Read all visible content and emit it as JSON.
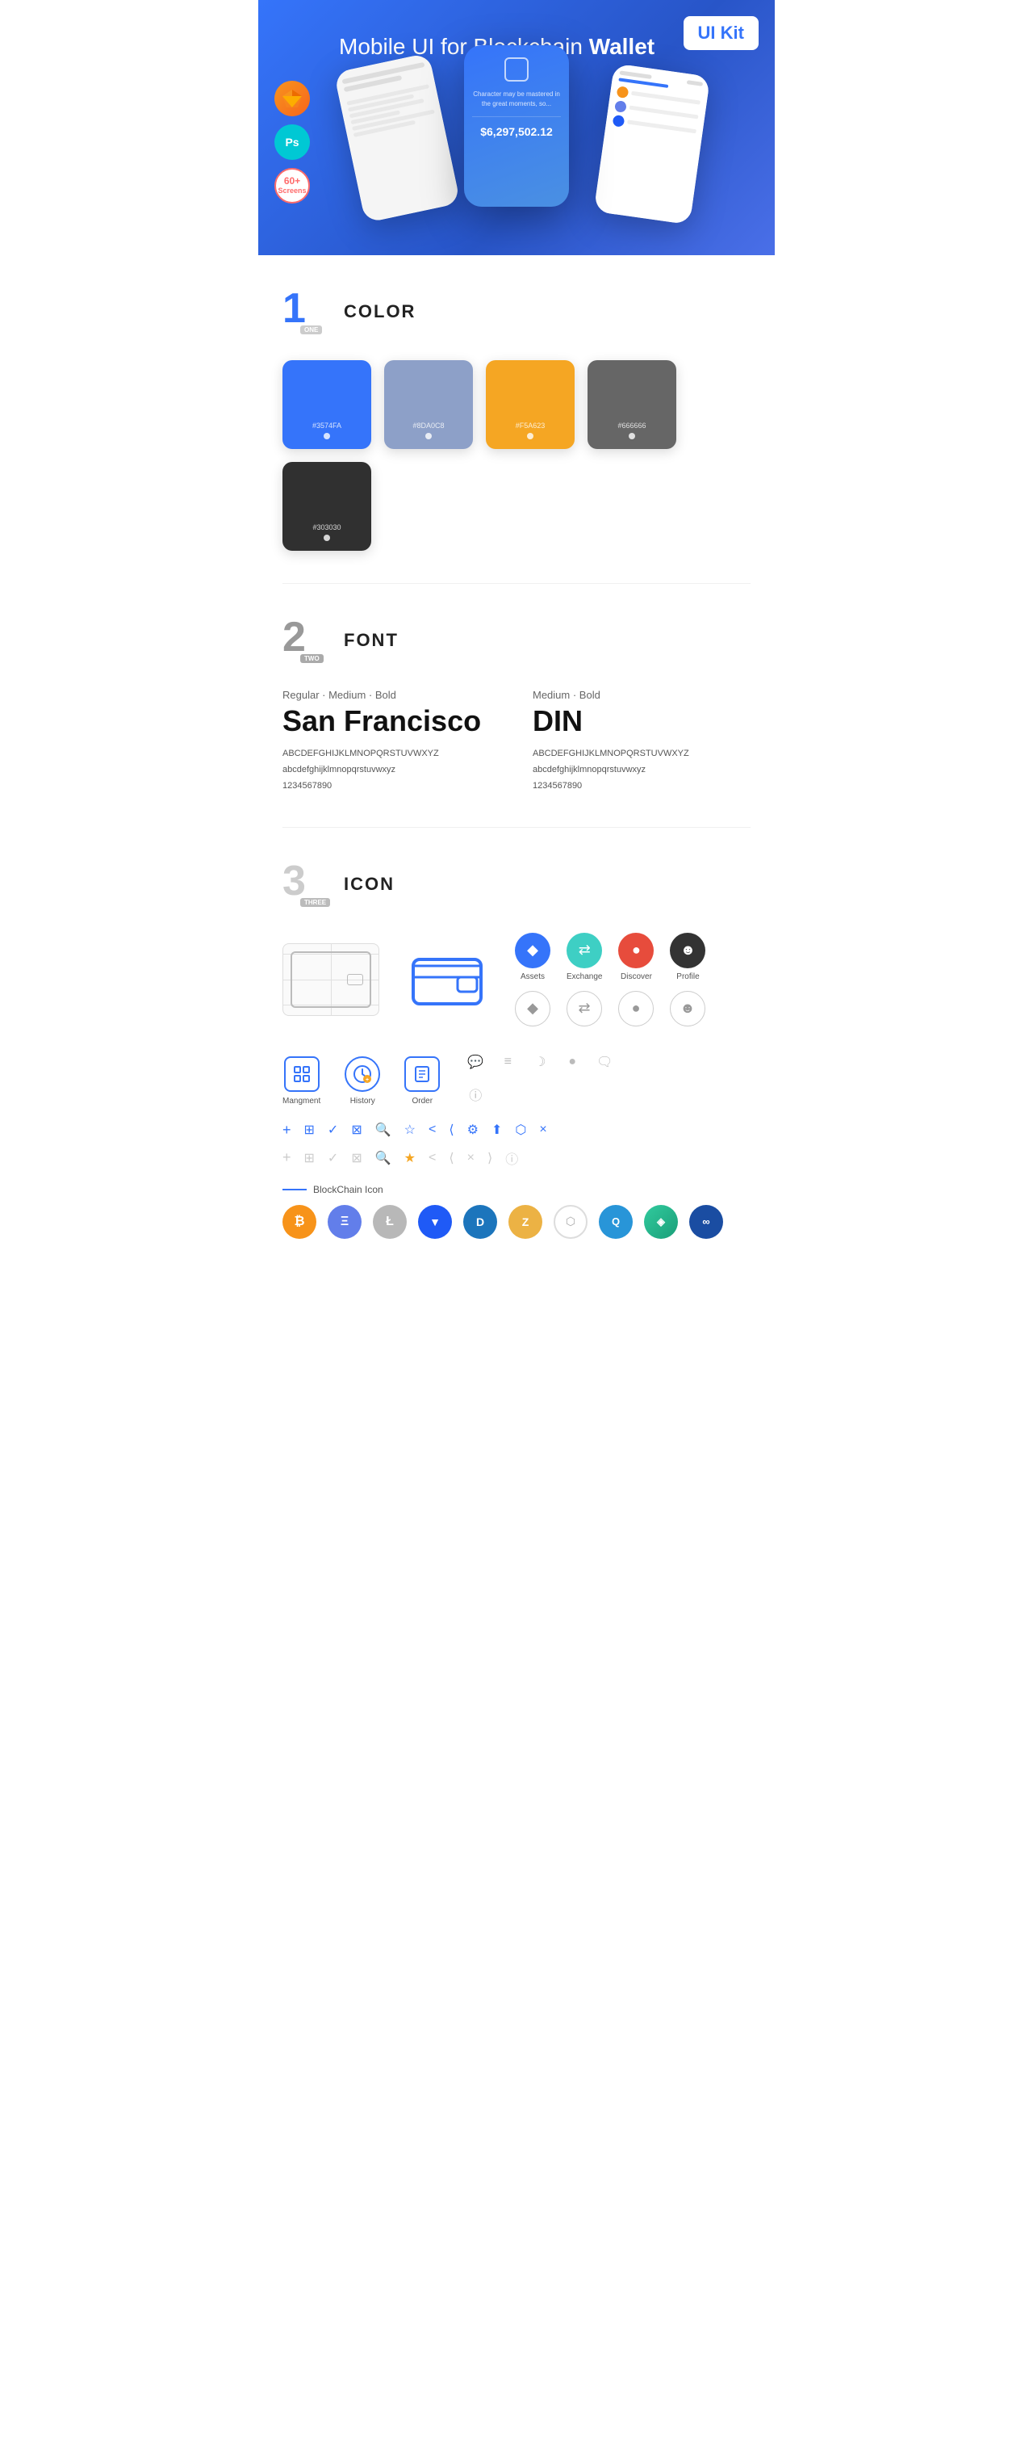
{
  "hero": {
    "title_normal": "Mobile UI for Blockchain ",
    "title_bold": "Wallet",
    "badge": "UI Kit",
    "badge_sketch": "◆",
    "badge_ps": "Ps",
    "badge_screens_num": "60+",
    "badge_screens_label": "Screens"
  },
  "sections": {
    "color": {
      "number": "1",
      "number_label": "ONE",
      "title": "COLOR",
      "swatches": [
        {
          "color": "#3574FA",
          "code": "#3574FA"
        },
        {
          "color": "#8DA0C8",
          "code": "#8DA0C8"
        },
        {
          "color": "#F5A623",
          "code": "#F5A623"
        },
        {
          "color": "#666666",
          "code": "#666666"
        },
        {
          "color": "#303030",
          "code": "#303030"
        }
      ]
    },
    "font": {
      "number": "2",
      "number_label": "TWO",
      "title": "FONT",
      "fonts": [
        {
          "styles": "Regular · Medium · Bold",
          "name": "San Francisco",
          "uppercase": "ABCDEFGHIJKLMNOPQRSTUVWXYZ",
          "lowercase": "abcdefghijklmnopqrstuvwxyz",
          "numbers": "1234567890"
        },
        {
          "styles": "Medium · Bold",
          "name": "DIN",
          "uppercase": "ABCDEFGHIJKLMNOPQRSTUVWXYZ",
          "lowercase": "abcdefghijklmnopqrstuvwxyz",
          "numbers": "1234567890"
        }
      ]
    },
    "icon": {
      "number": "3",
      "number_label": "THREE",
      "title": "ICON",
      "tab_icons": [
        {
          "label": "Assets",
          "symbol": "◆"
        },
        {
          "label": "Exchange",
          "symbol": "⇄"
        },
        {
          "label": "Discover",
          "symbol": "●"
        },
        {
          "label": "Profile",
          "symbol": "☻"
        }
      ],
      "nav_icons": [
        {
          "label": "Mangment",
          "symbol": "▣"
        },
        {
          "label": "History",
          "symbol": "⏱"
        },
        {
          "label": "Order",
          "symbol": "≡"
        }
      ],
      "misc_icons": [
        "+",
        "⊞",
        "✓",
        "⊠",
        "🔍",
        "☆",
        "<",
        "⟨",
        "⚙",
        "⬛",
        "⬡",
        "×"
      ],
      "blockchain_label": "BlockChain Icon",
      "crypto_coins": [
        {
          "symbol": "₿",
          "name": "Bitcoin",
          "color": "#F7931A",
          "text_color": "#fff"
        },
        {
          "symbol": "Ξ",
          "name": "Ethereum",
          "color": "#627EEA",
          "text_color": "#fff"
        },
        {
          "symbol": "Ł",
          "name": "Litecoin",
          "color": "#B8B8B8",
          "text_color": "#fff"
        },
        {
          "symbol": "⋄",
          "name": "Waves",
          "color": "#1F5AF6",
          "text_color": "#fff"
        },
        {
          "symbol": "D",
          "name": "Dash",
          "color": "#1C75BC",
          "text_color": "#fff"
        },
        {
          "symbol": "Z",
          "name": "Zcash",
          "color": "#ECB244",
          "text_color": "#fff"
        },
        {
          "symbol": "#",
          "name": "Grid",
          "color": "#fff",
          "text_color": "#aaa"
        },
        {
          "symbol": "Q",
          "name": "Qtum",
          "color": "#2895D8",
          "text_color": "#fff"
        },
        {
          "symbol": "K",
          "name": "Kyber",
          "color": "#31CB9E",
          "text_color": "#fff"
        },
        {
          "symbol": "O",
          "name": "OMG",
          "color": "#1A4DA2",
          "text_color": "#fff"
        }
      ]
    }
  }
}
